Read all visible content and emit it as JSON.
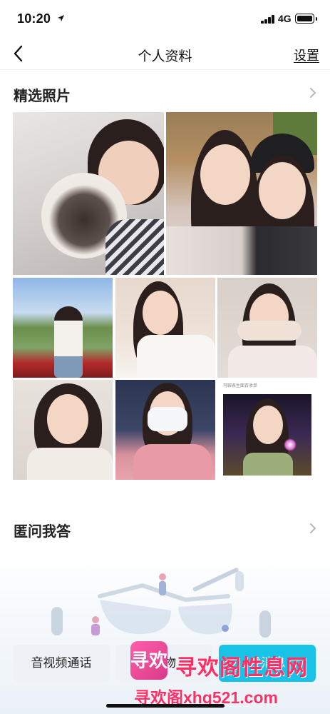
{
  "status_bar": {
    "time": "10:20",
    "network": "4G"
  },
  "nav": {
    "title": "个人资料",
    "settings_label": "设置"
  },
  "featured_photos": {
    "title": "精选照片"
  },
  "qa_section": {
    "title": "匿问我答"
  },
  "photo_caption": "可聊表生面百收单",
  "bottom_actions": {
    "call_label": "音视频通话",
    "gift_label": "礼物",
    "message_label": "发消息"
  },
  "watermark": {
    "logo_text": "寻欢",
    "line1": "寻欢阁性息网",
    "line2": "寻欢阁xhg521.com"
  },
  "colors": {
    "accent": "#19c3e8",
    "button_bg": "#eef2f7",
    "watermark": "#ff2e63"
  }
}
